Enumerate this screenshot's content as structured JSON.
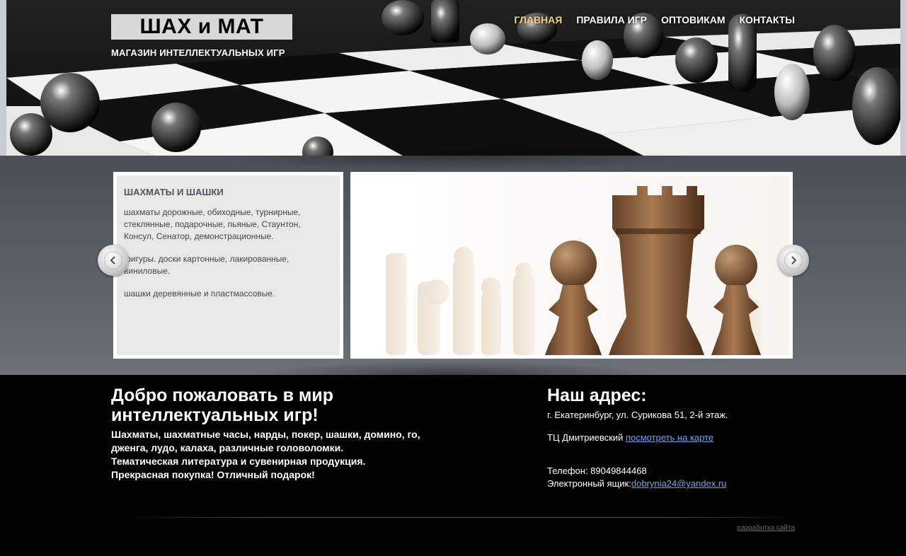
{
  "header": {
    "logo": "ШАХ и МАТ",
    "tagline": "МАГАЗИН ИНТЕЛЛЕКТУАЛЬНЫХ ИГР",
    "nav": [
      {
        "label": "ГЛАВНАЯ",
        "active": true
      },
      {
        "label": "ПРАВИЛА ИГР",
        "active": false
      },
      {
        "label": "ОПТОВИКАМ",
        "active": false
      },
      {
        "label": "КОНТАКТЫ",
        "active": false
      }
    ]
  },
  "slider": {
    "title": "ШАХМАТЫ И ШАШКИ",
    "paragraphs": [
      "шахматы дорожные, обиходные, турнирные, стеклянные, подарочные, пьяные, Стаунтон, Консул, Сенатор, демонстрационные.",
      "фигуры. доски картонные, лакированные, виниловые.",
      "шашки деревянные и пластмассовые."
    ],
    "prev_icon": "chevron-left-icon",
    "next_icon": "chevron-right-icon"
  },
  "welcome": {
    "title": "Добро пожаловать в мир интеллектуальных игр!",
    "lines": [
      "Шахматы, шахматные часы, нарды, покер, шашки, домино, го, дженга, лудо, калаха, различные головоломки.",
      "Тематическая литература и сувенирная продукция.",
      "Прекрасная покупка! Отличный подарок!"
    ]
  },
  "address": {
    "title": "Наш адрес:",
    "street": "г. Екатеринбург, ул. Сурикова 51, 2-й этаж.",
    "mall": "ТЦ Дмитриевский",
    "map_link": "посмотреть на карте",
    "phone": "Телефон: 89049844468",
    "email_label": "Электронный ящик:",
    "email": "dobrynia24@yandex.ru"
  },
  "footer": {
    "dev_link": "разработка сайта"
  },
  "colors": {
    "nav_active": "#f3d28c",
    "link": "#6fa3e8",
    "card_title": "#4a5566"
  }
}
